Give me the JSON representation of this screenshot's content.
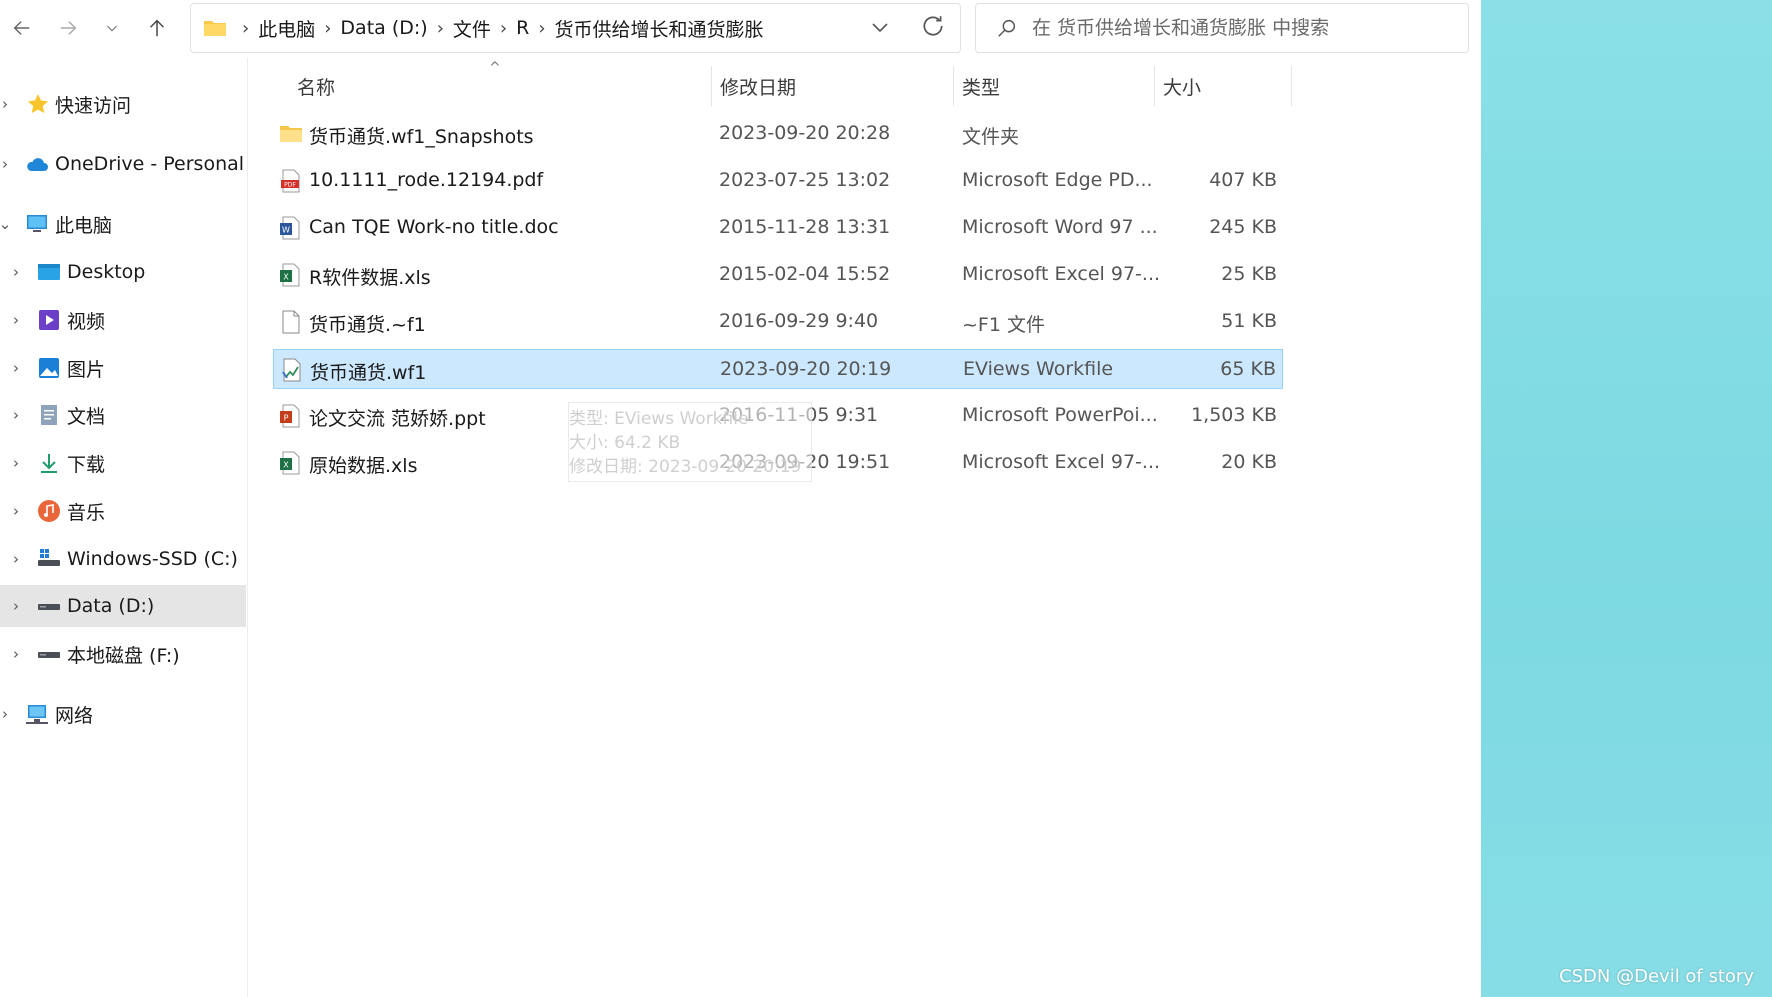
{
  "breadcrumb": [
    "此电脑",
    "Data (D:)",
    "文件",
    "R",
    "货币供给增长和通货膨胀"
  ],
  "search": {
    "placeholder": "在 货币供给增长和通货膨胀 中搜索"
  },
  "sidebar": {
    "items": [
      {
        "label": "快速访问",
        "icon": "star-icon"
      },
      {
        "label": "OneDrive - Personal",
        "icon": "cloud-icon"
      },
      {
        "label": "此电脑",
        "icon": "computer-icon"
      },
      {
        "label": "Desktop",
        "icon": "desktop-icon"
      },
      {
        "label": "视频",
        "icon": "video-icon"
      },
      {
        "label": "图片",
        "icon": "pictures-icon"
      },
      {
        "label": "文档",
        "icon": "documents-icon"
      },
      {
        "label": "下载",
        "icon": "download-icon"
      },
      {
        "label": "音乐",
        "icon": "music-icon"
      },
      {
        "label": "Windows-SSD (C:)",
        "icon": "windows-drive-icon"
      },
      {
        "label": "Data (D:)",
        "icon": "drive-icon"
      },
      {
        "label": "本地磁盘 (F:)",
        "icon": "drive-icon"
      },
      {
        "label": "网络",
        "icon": "network-icon"
      }
    ]
  },
  "columns": {
    "name": "名称",
    "date": "修改日期",
    "type": "类型",
    "size": "大小"
  },
  "files": [
    {
      "name": "货币通货.wf1_Snapshots",
      "date": "2023-09-20 20:28",
      "type": "文件夹",
      "size": "",
      "icon": "folder-icon"
    },
    {
      "name": "10.1111_rode.12194.pdf",
      "date": "2023-07-25 13:02",
      "type": "Microsoft Edge PD...",
      "size": "407 KB",
      "icon": "pdf-icon"
    },
    {
      "name": "Can TQE Work-no title.doc",
      "date": "2015-11-28 13:31",
      "type": "Microsoft Word 97 ...",
      "size": "245 KB",
      "icon": "word-icon"
    },
    {
      "name": "R软件数据.xls",
      "date": "2015-02-04 15:52",
      "type": "Microsoft Excel 97-...",
      "size": "25 KB",
      "icon": "excel-icon"
    },
    {
      "name": "货币通货.~f1",
      "date": "2016-09-29 9:40",
      "type": "~F1 文件",
      "size": "51 KB",
      "icon": "blank-file-icon"
    },
    {
      "name": "货币通货.wf1",
      "date": "2023-09-20 20:19",
      "type": "EViews Workfile",
      "size": "65 KB",
      "icon": "eviews-icon"
    },
    {
      "name": "论文交流 范娇娇.ppt",
      "date": "2016-11-05 9:31",
      "type": "Microsoft PowerPoi...",
      "size": "1,503 KB",
      "icon": "powerpoint-icon"
    },
    {
      "name": "原始数据.xls",
      "date": "2023-09-20 19:51",
      "type": "Microsoft Excel 97-...",
      "size": "20 KB",
      "icon": "excel-icon"
    }
  ],
  "tooltip": {
    "type_line": "类型: EViews Workfile",
    "size_line": "大小: 64.2 KB",
    "date_line": "修改日期: 2023-09-20 20:19"
  },
  "watermark": "CSDN @Devil of story",
  "colors": {
    "selection_bg": "#cce8ff",
    "selection_border": "#99d1ff",
    "desktop_bg": "#7fdbe3"
  }
}
